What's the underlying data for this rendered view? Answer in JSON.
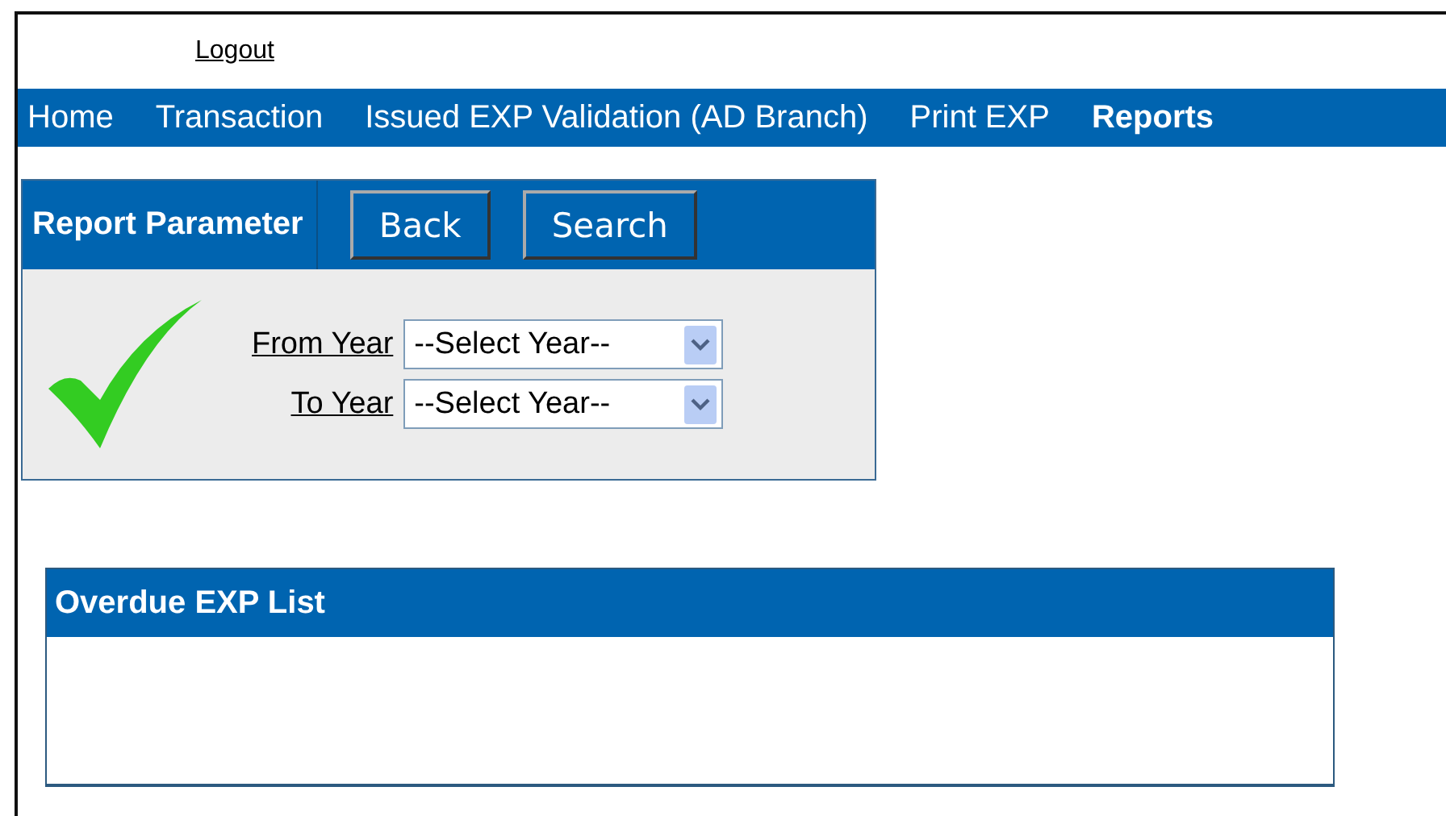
{
  "logout": "Logout",
  "nav": [
    {
      "label": "Home",
      "selected": false
    },
    {
      "label": "Transaction",
      "selected": false
    },
    {
      "label": "Issued EXP Validation (AD Branch)",
      "selected": false
    },
    {
      "label": "Print EXP",
      "selected": false
    },
    {
      "label": "Reports",
      "selected": true
    }
  ],
  "report_parameter": {
    "title": "Report Parameter",
    "buttons": [
      "Back",
      "Search"
    ],
    "fields": [
      {
        "label": "From Year",
        "value": "--Select Year--"
      },
      {
        "label": "To Year",
        "value": "--Select Year--"
      }
    ]
  },
  "list_panel": {
    "title": "Overdue EXP List"
  }
}
